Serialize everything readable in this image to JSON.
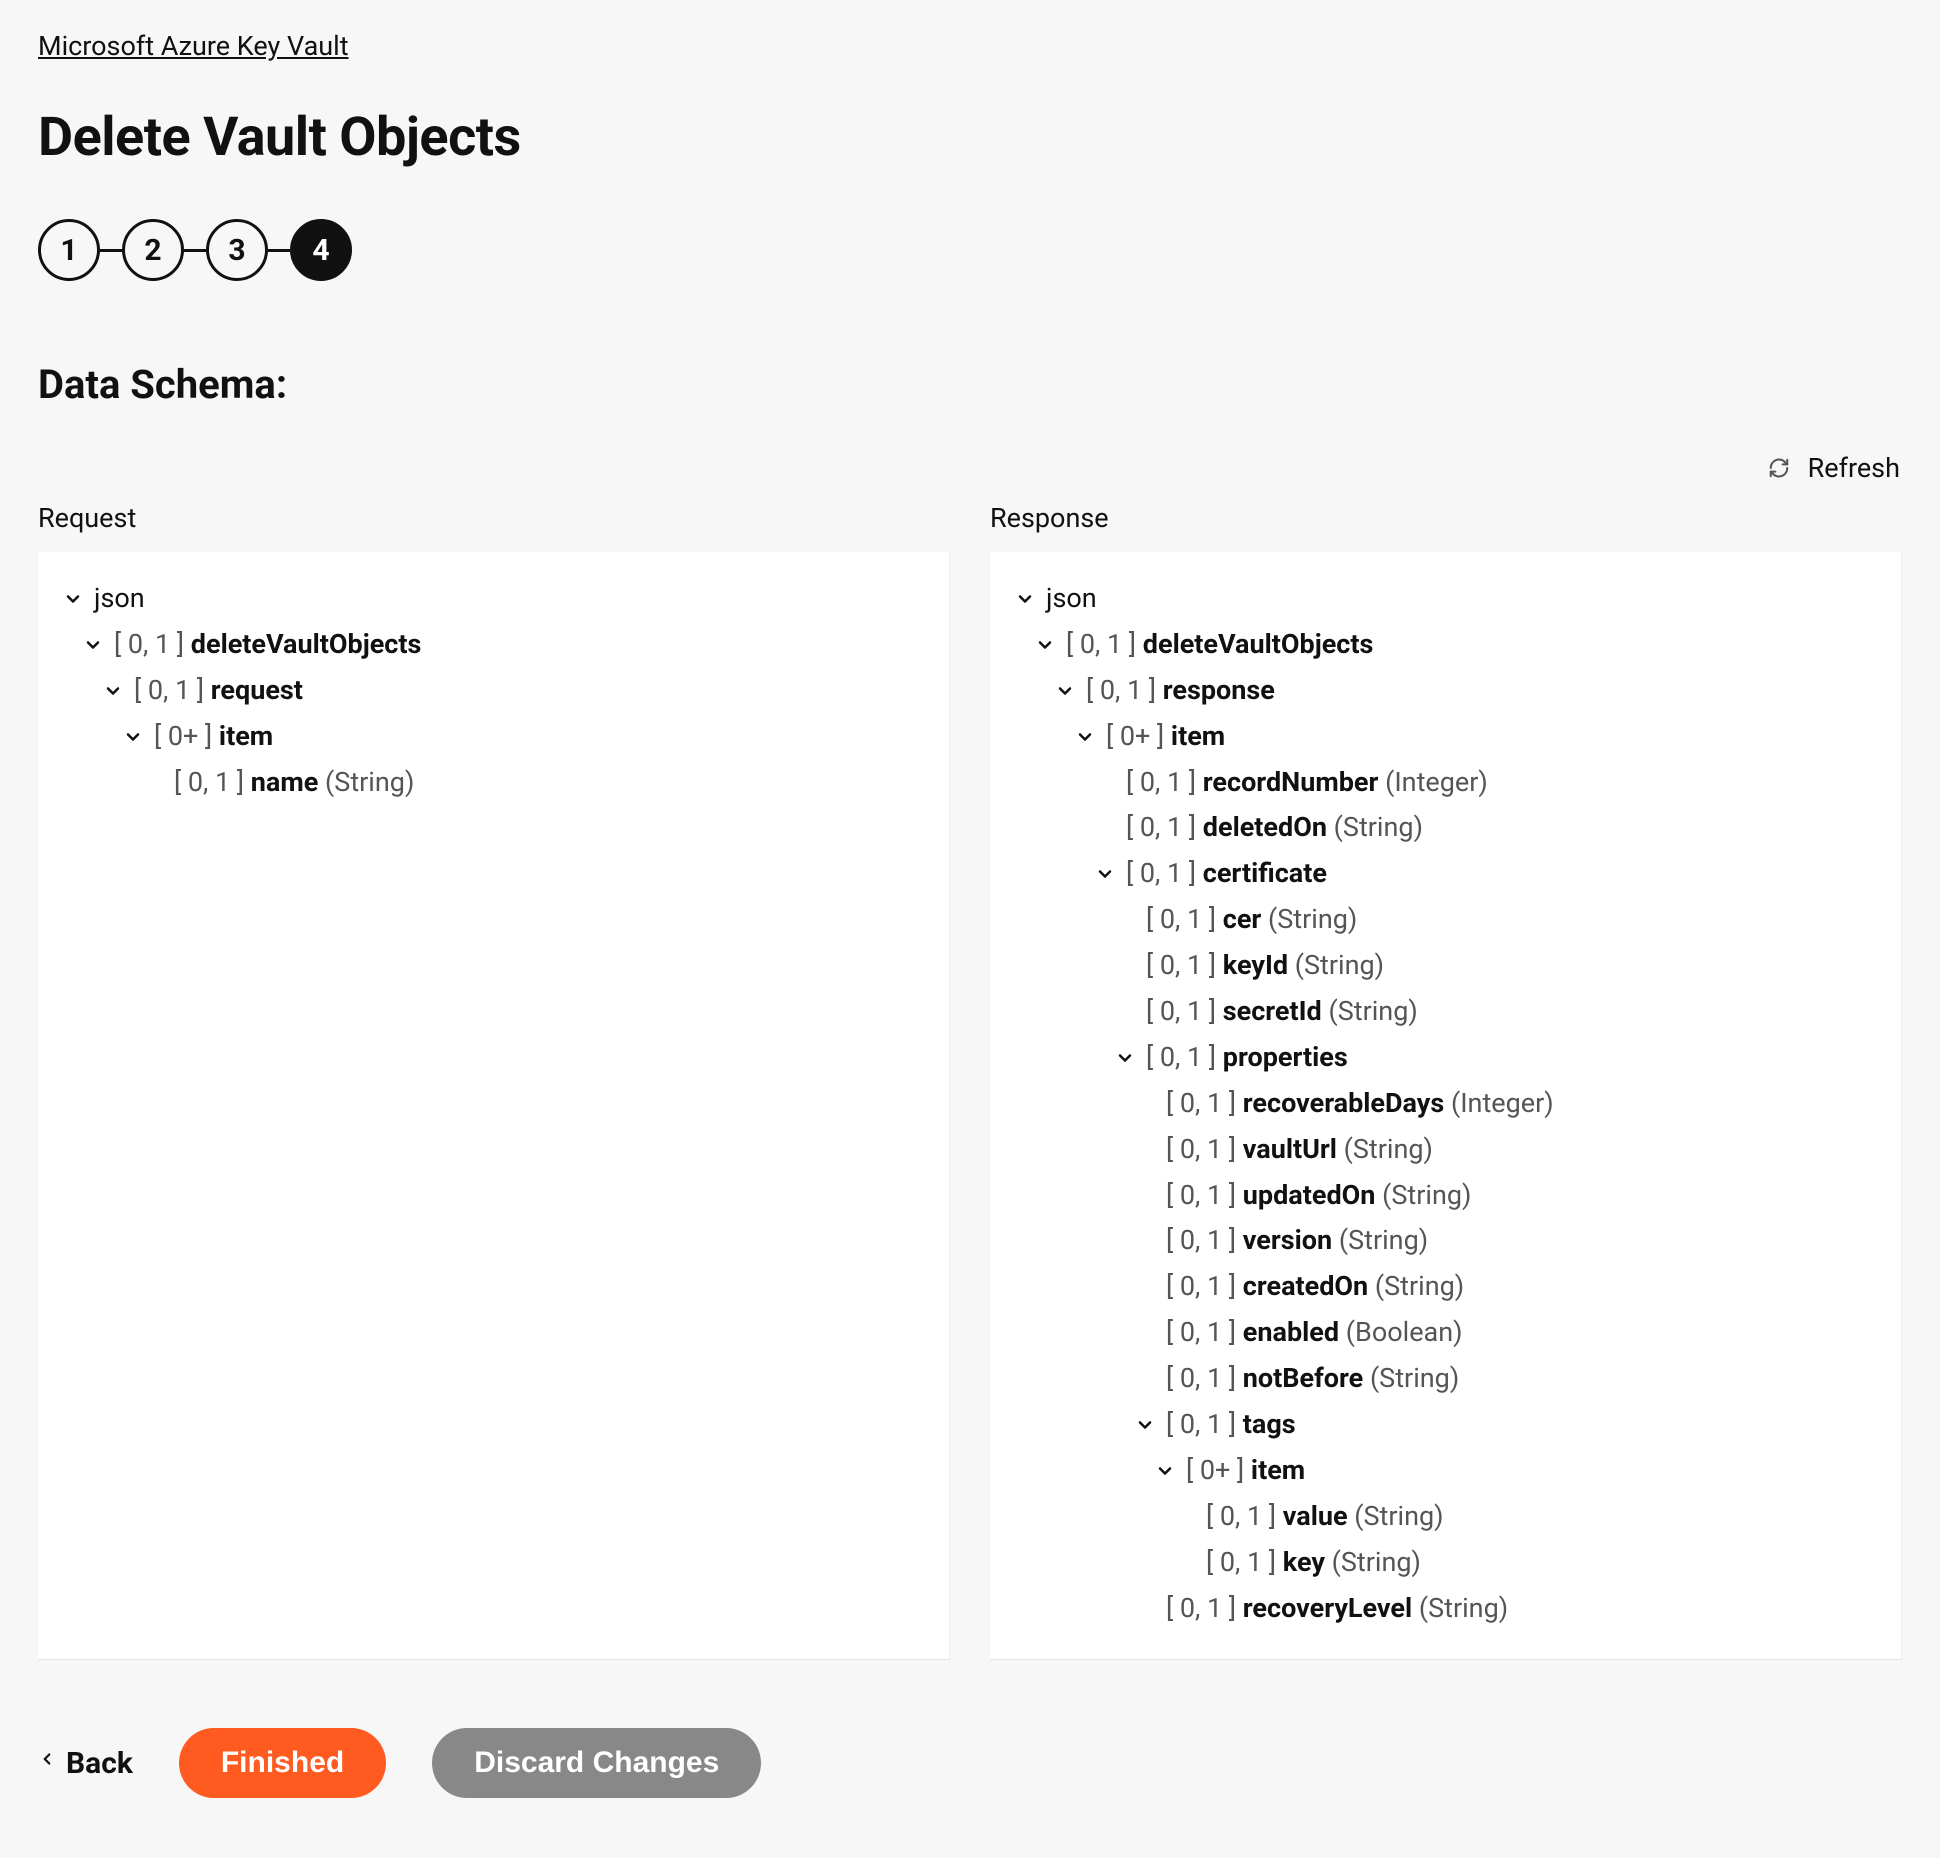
{
  "breadcrumb": "Microsoft Azure Key Vault",
  "pageTitle": "Delete Vault Objects",
  "steps": [
    "1",
    "2",
    "3",
    "4"
  ],
  "activeStep": 3,
  "sectionTitle": "Data Schema:",
  "refreshLabel": "Refresh",
  "panels": {
    "requestLabel": "Request",
    "responseLabel": "Response"
  },
  "schemas": {
    "request": [
      {
        "depth": 0,
        "chev": true,
        "card": "",
        "name": "json",
        "type": ""
      },
      {
        "depth": 1,
        "chev": true,
        "card": "[ 0, 1 ]",
        "name": "deleteVaultObjects",
        "type": ""
      },
      {
        "depth": 2,
        "chev": true,
        "card": "[ 0, 1 ]",
        "name": "request",
        "type": ""
      },
      {
        "depth": 3,
        "chev": true,
        "card": "[ 0+ ]",
        "name": "item",
        "type": ""
      },
      {
        "depth": 4,
        "chev": false,
        "card": "[ 0, 1 ]",
        "name": "name",
        "type": "(String)"
      }
    ],
    "response": [
      {
        "depth": 0,
        "chev": true,
        "card": "",
        "name": "json",
        "type": ""
      },
      {
        "depth": 1,
        "chev": true,
        "card": "[ 0, 1 ]",
        "name": "deleteVaultObjects",
        "type": ""
      },
      {
        "depth": 2,
        "chev": true,
        "card": "[ 0, 1 ]",
        "name": "response",
        "type": ""
      },
      {
        "depth": 3,
        "chev": true,
        "card": "[ 0+ ]",
        "name": "item",
        "type": ""
      },
      {
        "depth": 4,
        "chev": false,
        "card": "[ 0, 1 ]",
        "name": "recordNumber",
        "type": "(Integer)"
      },
      {
        "depth": 4,
        "chev": false,
        "card": "[ 0, 1 ]",
        "name": "deletedOn",
        "type": "(String)"
      },
      {
        "depth": 4,
        "chev": true,
        "card": "[ 0, 1 ]",
        "name": "certificate",
        "type": ""
      },
      {
        "depth": 5,
        "chev": false,
        "card": "[ 0, 1 ]",
        "name": "cer",
        "type": "(String)"
      },
      {
        "depth": 5,
        "chev": false,
        "card": "[ 0, 1 ]",
        "name": "keyId",
        "type": "(String)"
      },
      {
        "depth": 5,
        "chev": false,
        "card": "[ 0, 1 ]",
        "name": "secretId",
        "type": "(String)"
      },
      {
        "depth": 5,
        "chev": true,
        "card": "[ 0, 1 ]",
        "name": "properties",
        "type": ""
      },
      {
        "depth": 6,
        "chev": false,
        "card": "[ 0, 1 ]",
        "name": "recoverableDays",
        "type": "(Integer)"
      },
      {
        "depth": 6,
        "chev": false,
        "card": "[ 0, 1 ]",
        "name": "vaultUrl",
        "type": "(String)"
      },
      {
        "depth": 6,
        "chev": false,
        "card": "[ 0, 1 ]",
        "name": "updatedOn",
        "type": "(String)"
      },
      {
        "depth": 6,
        "chev": false,
        "card": "[ 0, 1 ]",
        "name": "version",
        "type": "(String)"
      },
      {
        "depth": 6,
        "chev": false,
        "card": "[ 0, 1 ]",
        "name": "createdOn",
        "type": "(String)"
      },
      {
        "depth": 6,
        "chev": false,
        "card": "[ 0, 1 ]",
        "name": "enabled",
        "type": "(Boolean)"
      },
      {
        "depth": 6,
        "chev": false,
        "card": "[ 0, 1 ]",
        "name": "notBefore",
        "type": "(String)"
      },
      {
        "depth": 6,
        "chev": true,
        "card": "[ 0, 1 ]",
        "name": "tags",
        "type": ""
      },
      {
        "depth": 7,
        "chev": true,
        "card": "[ 0+ ]",
        "name": "item",
        "type": ""
      },
      {
        "depth": 8,
        "chev": false,
        "card": "[ 0, 1 ]",
        "name": "value",
        "type": "(String)"
      },
      {
        "depth": 8,
        "chev": false,
        "card": "[ 0, 1 ]",
        "name": "key",
        "type": "(String)"
      },
      {
        "depth": 6,
        "chev": false,
        "card": "[ 0, 1 ]",
        "name": "recoveryLevel",
        "type": "(String)"
      }
    ]
  },
  "footer": {
    "back": "Back",
    "finished": "Finished",
    "discard": "Discard Changes"
  }
}
